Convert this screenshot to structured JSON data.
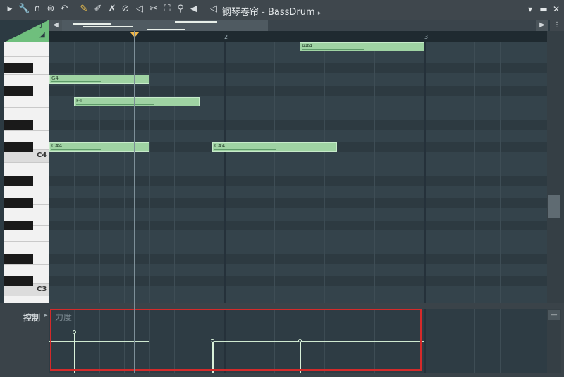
{
  "title": {
    "prefix": "钢琴卷帘",
    "separator": " - ",
    "channel": "BassDrum"
  },
  "toolbar": {
    "icons": [
      "play-arrow-icon",
      "wrench-icon",
      "magnet-icon",
      "menu-circle-icon",
      "undo-icon",
      "pencil-icon",
      "paint-brush-icon",
      "delete-icon",
      "mute-icon",
      "slash-icon",
      "slice-icon",
      "select-icon",
      "zoom-icon",
      "playback-icon",
      "speaker-icon"
    ]
  },
  "ruler": {
    "bars": [
      "2",
      "3"
    ]
  },
  "piano": {
    "labels": [
      "C4",
      "C3"
    ]
  },
  "notes": [
    {
      "label": "A#4",
      "col": 4
    },
    {
      "label": "G4",
      "col": 1
    },
    {
      "label": "F4",
      "col": 2
    },
    {
      "label": "C#4",
      "col": 1
    },
    {
      "label": "C#4",
      "col": 3
    }
  ],
  "control": {
    "label": "控制",
    "parameter": "力度"
  },
  "colors": {
    "note": "#9fd3a3",
    "accent": "#f2b94b",
    "highlight": "#d42a2a",
    "grid": "#34434b"
  }
}
